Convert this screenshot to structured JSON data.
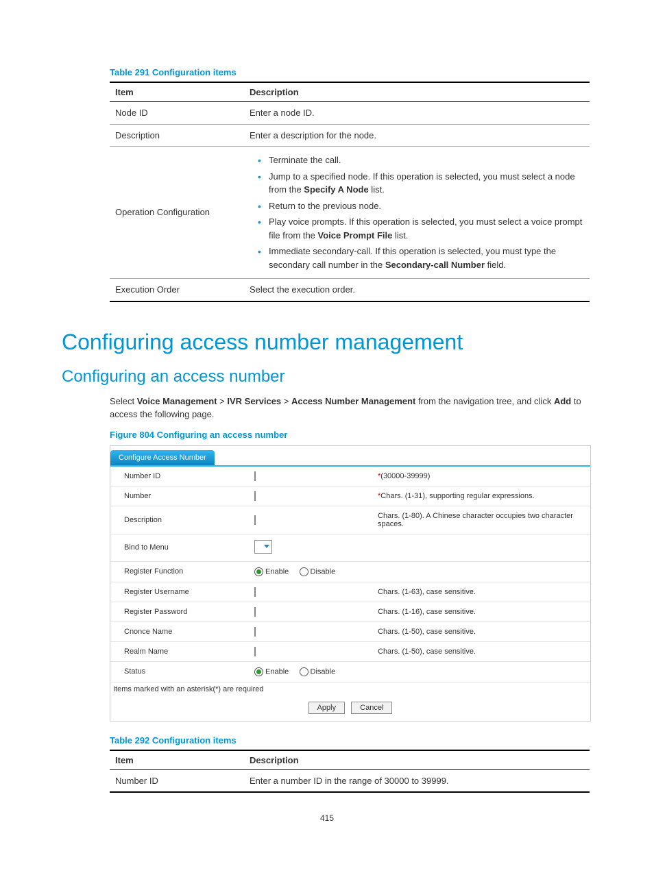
{
  "page_number": "415",
  "table291": {
    "caption": "Table 291 Configuration items",
    "head_item": "Item",
    "head_desc": "Description",
    "rows": [
      {
        "item": "Node ID",
        "desc": "Enter a node ID."
      },
      {
        "item": "Description",
        "desc": "Enter a description for the node."
      }
    ],
    "opconf": {
      "item": "Operation Configuration",
      "b1": "Terminate the call.",
      "b2a": "Jump to a specified node. If this operation is selected, you must select a node from the ",
      "b2b": "Specify A Node",
      "b2c": " list.",
      "b3": "Return to the previous node.",
      "b4a": "Play voice prompts. If this operation is selected, you must select a voice prompt file from the ",
      "b4b": "Voice Prompt File",
      "b4c": " list.",
      "b5a": "Immediate secondary-call. If this operation is selected, you must type the secondary call number in the ",
      "b5b": "Secondary-call Number",
      "b5c": " field."
    },
    "row_exec": {
      "item": "Execution Order",
      "desc": "Select the execution order."
    }
  },
  "h1": "Configuring access number management",
  "h2": "Configuring an access number",
  "intro": {
    "a": "Select ",
    "b": "Voice Management",
    "sep": " > ",
    "c": "IVR Services",
    "d": "Access Number Management",
    "e": " from the navigation tree, and click ",
    "f": "Add",
    "g": " to access the following page."
  },
  "figure": {
    "caption": "Figure 804 Configuring an access number",
    "tab": "Configure Access Number",
    "rows": {
      "numberid": {
        "label": "Number ID",
        "hint_a": "*",
        "hint_b": "(30000-39999)"
      },
      "number": {
        "label": "Number",
        "hint_a": "*",
        "hint_b": "Chars. (1-31), supporting regular expressions."
      },
      "desc": {
        "label": "Description",
        "hint": "Chars. (1-80). A Chinese character occupies two character spaces."
      },
      "bind": {
        "label": "Bind to Menu"
      },
      "regfunc": {
        "label": "Register Function",
        "enable": "Enable",
        "disable": "Disable"
      },
      "reguser": {
        "label": "Register Username",
        "hint": "Chars. (1-63), case sensitive."
      },
      "regpass": {
        "label": "Register Password",
        "hint": "Chars. (1-16), case sensitive."
      },
      "cnonce": {
        "label": "Cnonce Name",
        "hint": "Chars. (1-50), case sensitive."
      },
      "realm": {
        "label": "Realm Name",
        "hint": "Chars. (1-50), case sensitive."
      },
      "status": {
        "label": "Status",
        "enable": "Enable",
        "disable": "Disable"
      }
    },
    "note": "Items marked with an asterisk(*) are required",
    "apply": "Apply",
    "cancel": "Cancel"
  },
  "table292": {
    "caption": "Table 292 Configuration items",
    "head_item": "Item",
    "head_desc": "Description",
    "row": {
      "item": "Number ID",
      "desc": "Enter a number ID in the range of 30000 to 39999."
    }
  }
}
